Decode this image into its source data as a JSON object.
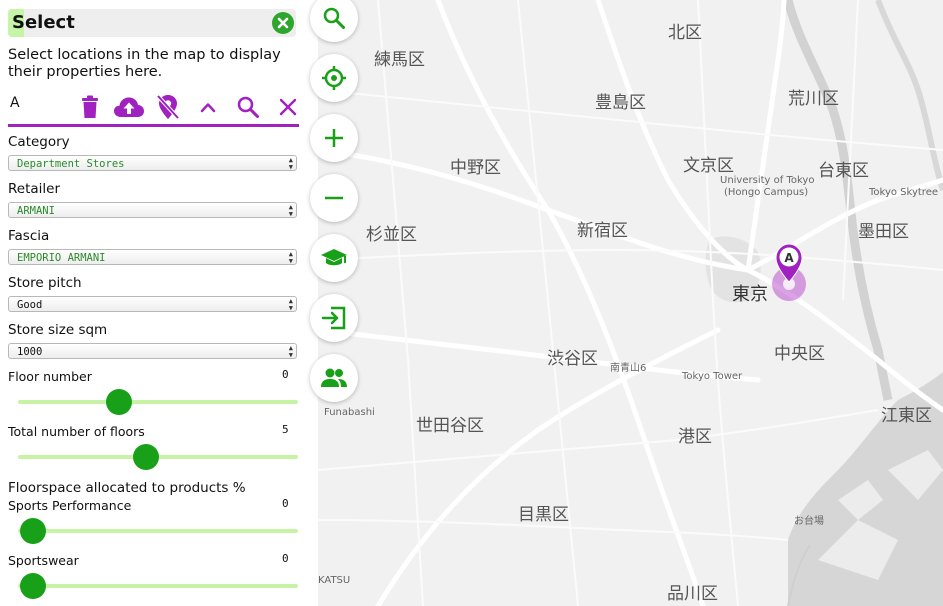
{
  "panel": {
    "title": "Select",
    "help_text": "Select locations in the map to display their properties here.",
    "marker_letter": "A",
    "fields": [
      {
        "label": "Category",
        "value": "Department Stores"
      },
      {
        "label": "Retailer",
        "value": "ARMANI"
      },
      {
        "label": "Fascia",
        "value": "EMPORIO ARMANI"
      },
      {
        "label": "Store pitch",
        "value": "Good"
      },
      {
        "label": "Store size sqm",
        "value": "1000"
      }
    ],
    "sliders_top": [
      {
        "label": "Floor number",
        "value": "0",
        "fraction": 0.36
      },
      {
        "label": "Total number of floors",
        "value": "5",
        "fraction": 0.456
      }
    ],
    "floorspace_heading": "Floorspace allocated to products %",
    "sliders_floorspace": [
      {
        "label": "Sports Performance",
        "value": "0",
        "fraction": 0.055
      },
      {
        "label": "Sportswear",
        "value": "0",
        "fraction": 0.055
      }
    ]
  },
  "toolbar_icons": [
    "trash-icon",
    "cloud-upload-icon",
    "remove-pin-icon",
    "chevron-up-icon",
    "search-icon",
    "close-icon"
  ],
  "map_controls": [
    "search-icon",
    "locate-icon",
    "zoom-in-icon",
    "zoom-out-icon",
    "education-icon",
    "export-icon",
    "users-icon"
  ],
  "map": {
    "marker_letter": "A",
    "labels": [
      {
        "name": "north-ward",
        "text": "北区"
      },
      {
        "name": "nerima-ward",
        "text": "練馬区"
      },
      {
        "name": "toshima-ward",
        "text": "豊島区"
      },
      {
        "name": "arakawa-ward",
        "text": "荒川区"
      },
      {
        "name": "nakano-ward",
        "text": "中野区"
      },
      {
        "name": "bunkyo-ward",
        "text": "文京区"
      },
      {
        "name": "taito-ward",
        "text": "台東区"
      },
      {
        "name": "univ-tokyo",
        "text": "University of Tokyo"
      },
      {
        "name": "hongo-campus",
        "text": "(Hongo Campus)"
      },
      {
        "name": "tokyo-skytree",
        "text": "Tokyo Skytree"
      },
      {
        "name": "suginami-ward",
        "text": "杉並区"
      },
      {
        "name": "shinjuku-ward",
        "text": "新宿区"
      },
      {
        "name": "sumida-ward",
        "text": "墨田区"
      },
      {
        "name": "tokyo-city",
        "text": "東京"
      },
      {
        "name": "chuo-ward",
        "text": "中央区"
      },
      {
        "name": "shibuya-ward",
        "text": "渋谷区"
      },
      {
        "name": "minami-aoyama",
        "text": "南青山6"
      },
      {
        "name": "tokyo-tower",
        "text": "Tokyo Tower"
      },
      {
        "name": "funabashi",
        "text": "Funabashi"
      },
      {
        "name": "setagaya-ward",
        "text": "世田谷区"
      },
      {
        "name": "minato-ward",
        "text": "港区"
      },
      {
        "name": "koto-ward",
        "text": "江東区"
      },
      {
        "name": "meguro-ward",
        "text": "目黒区"
      },
      {
        "name": "odaiba",
        "text": "お台場"
      },
      {
        "name": "katsu",
        "text": "KATSU"
      },
      {
        "name": "shinagawa-ward",
        "text": "品川区"
      }
    ]
  },
  "colors": {
    "accent_purple": "#a020c0",
    "marker_purple": "#b030c8",
    "green": "#18a018",
    "track_green": "#c7f3a4"
  }
}
